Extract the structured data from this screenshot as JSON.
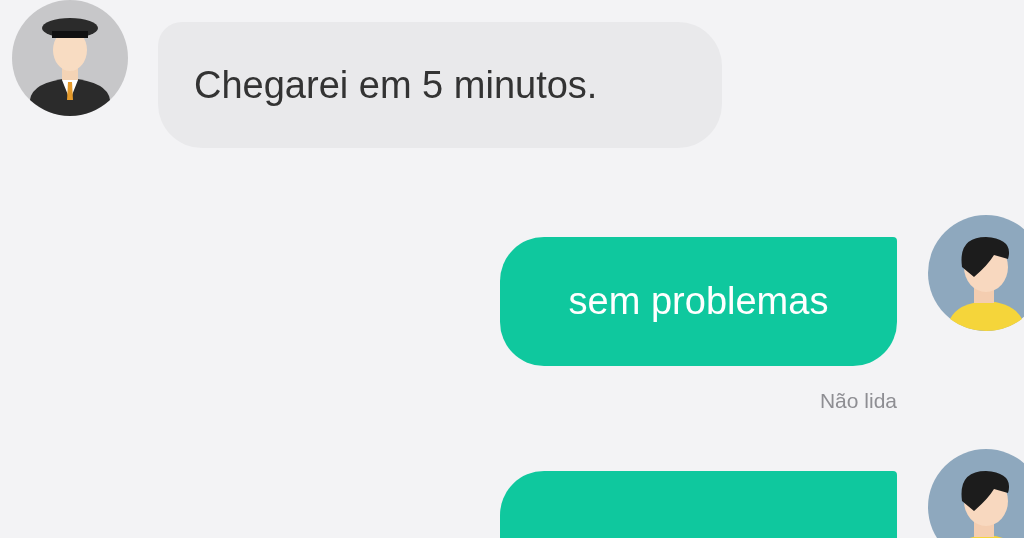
{
  "messages": [
    {
      "kind": "incoming",
      "text": "Chegarei em 5 minutos."
    },
    {
      "kind": "outgoing",
      "text": "sem problemas",
      "status": "Não lida"
    },
    {
      "kind": "outgoing"
    }
  ]
}
